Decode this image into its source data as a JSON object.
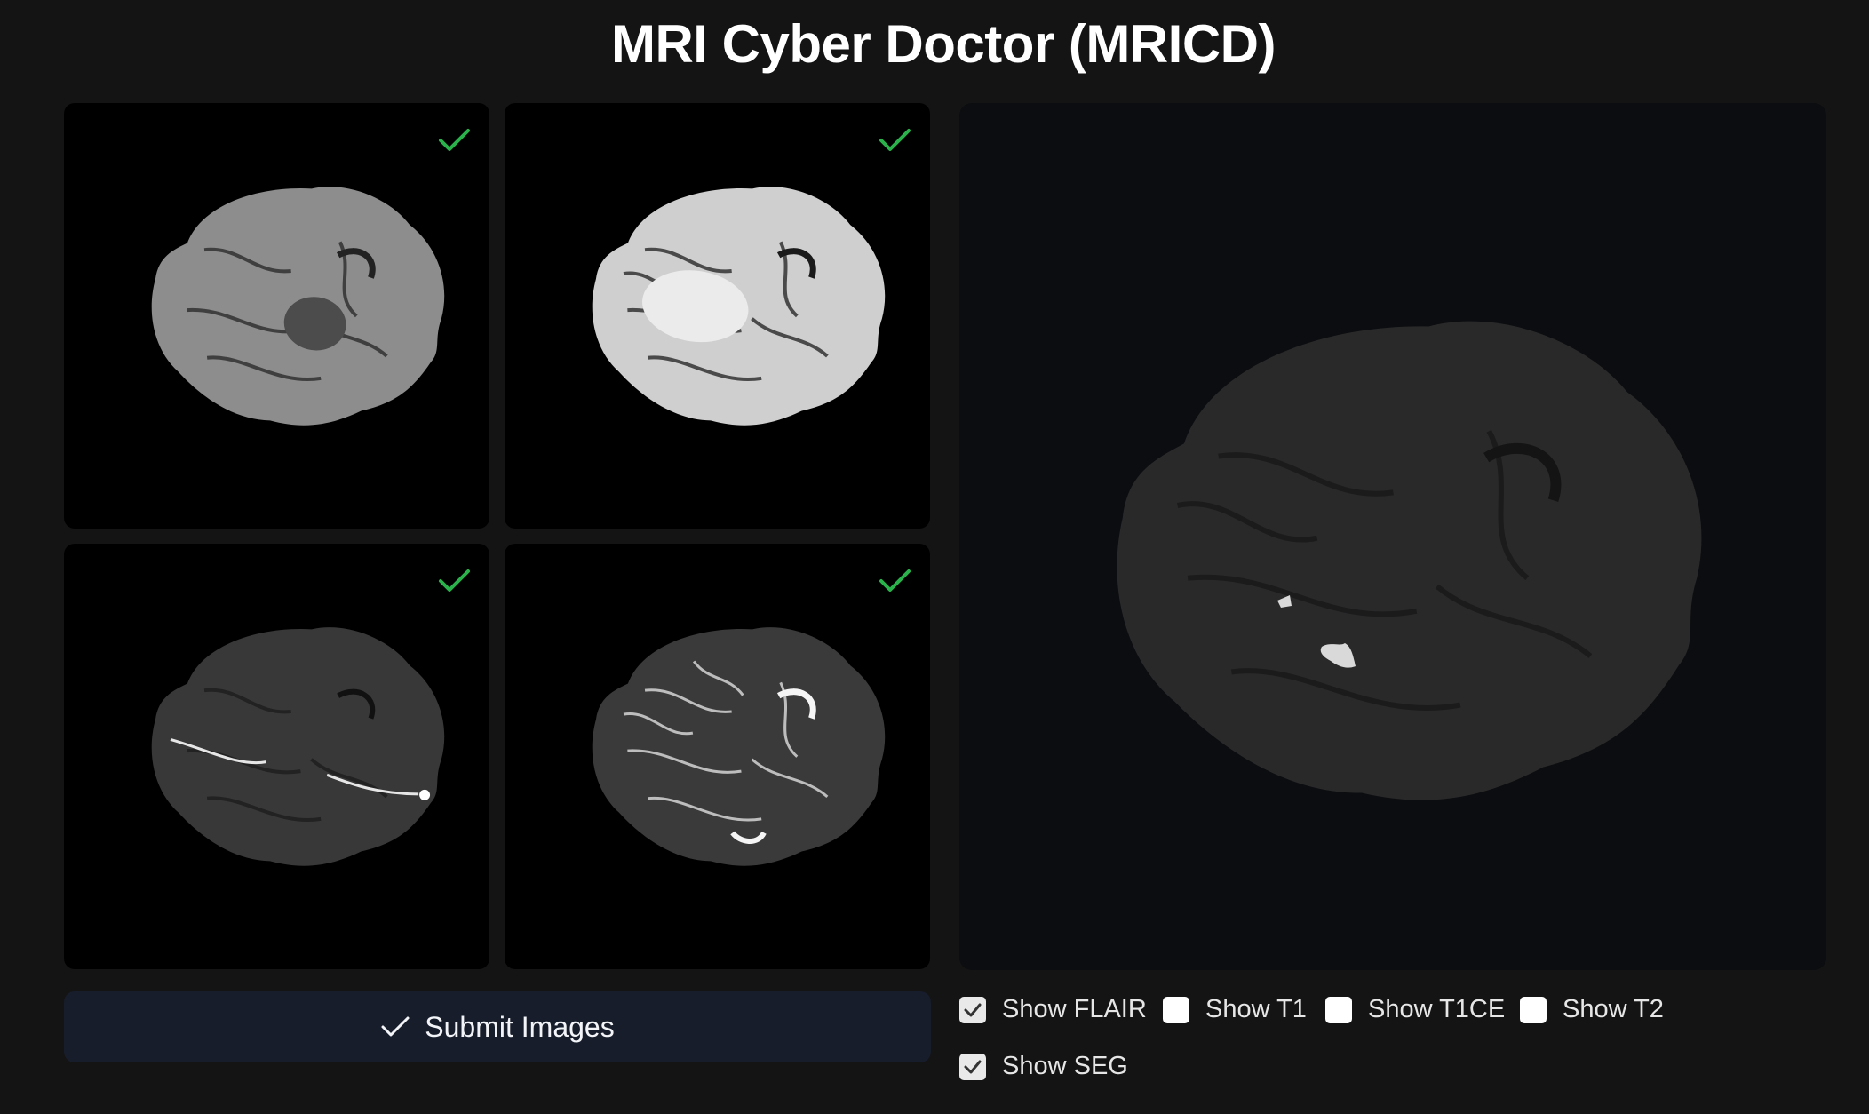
{
  "app": {
    "title": "MRI Cyber Doctor (MRICD)"
  },
  "slots": [
    {
      "modality": "flair",
      "uploaded": true
    },
    {
      "modality": "t1",
      "uploaded": true
    },
    {
      "modality": "t1ce",
      "uploaded": true
    },
    {
      "modality": "t2",
      "uploaded": true
    }
  ],
  "submit": {
    "label": "Submit Images",
    "icon": "check-icon"
  },
  "controls": [
    {
      "label": "Show FLAIR",
      "checked": true
    },
    {
      "label": "Show T1",
      "checked": false
    },
    {
      "label": "Show T1CE",
      "checked": false
    },
    {
      "label": "Show T2",
      "checked": false
    },
    {
      "label": "Show SEG",
      "checked": true
    }
  ],
  "colors": {
    "background": "#141414",
    "check": "#2bb24c",
    "submit_bg": "#171d2a"
  }
}
